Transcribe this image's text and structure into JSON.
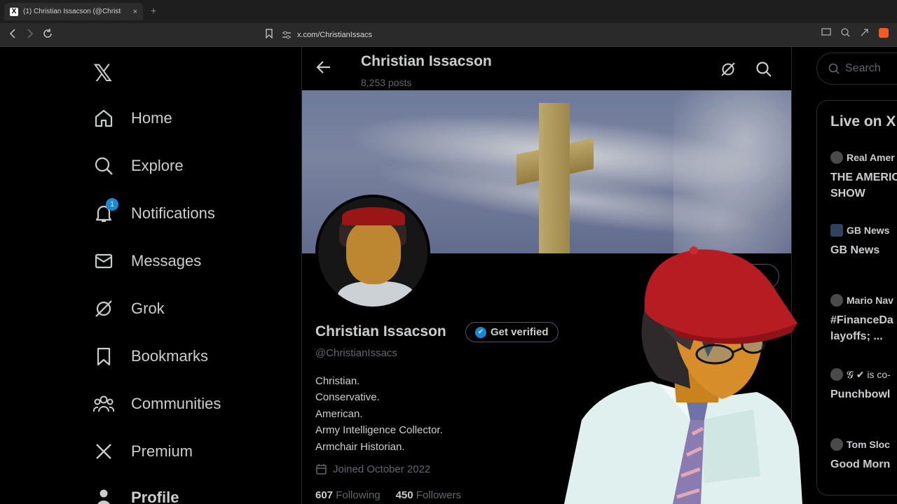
{
  "browser": {
    "tab_title": "(1) Christian Issacson (@ChristianIssacs",
    "tab_close": "×",
    "new_tab": "+",
    "url": "x.com/ChristianIssacs"
  },
  "nav": {
    "logo": "𝕏",
    "items": [
      {
        "label": "Home",
        "icon": "home-icon"
      },
      {
        "label": "Explore",
        "icon": "search-icon"
      },
      {
        "label": "Notifications",
        "icon": "bell-icon",
        "badge": "1"
      },
      {
        "label": "Messages",
        "icon": "envelope-icon"
      },
      {
        "label": "Grok",
        "icon": "grok-icon"
      },
      {
        "label": "Bookmarks",
        "icon": "bookmark-icon"
      },
      {
        "label": "Communities",
        "icon": "people-icon"
      },
      {
        "label": "Premium",
        "icon": "x-icon"
      },
      {
        "label": "Profile",
        "icon": "person-icon"
      }
    ]
  },
  "header": {
    "name": "Christian Issacson",
    "posts": "8,253 posts"
  },
  "profile": {
    "name": "Christian Issacson",
    "verify_label": "Get verified",
    "handle": "@ChristianIssacs",
    "bio": [
      "Christian.",
      "Conservative.",
      "American.",
      "Army Intelligence Collector.",
      "Armchair Historian."
    ],
    "joined": "Joined October 2022",
    "following_count": "607",
    "following_label": "Following",
    "followers_count": "450",
    "followers_label": "Followers"
  },
  "sidebar_right": {
    "search_placeholder": "Search",
    "live_title": "Live on X",
    "live_items": [
      {
        "host": "Real Amer",
        "topic": "THE AMERIC SHOW"
      },
      {
        "host": "GB News",
        "topic": "GB News"
      },
      {
        "host": "Mario Nav",
        "topic": "#FinanceDa layoffs; ..."
      },
      {
        "host": "𝓖 ✔ is co-",
        "topic": "Punchbowl"
      },
      {
        "host": "Tom Sloc",
        "topic": "Good Morn"
      }
    ]
  },
  "colors": {
    "accent": "#1d9bf0",
    "background": "#000000",
    "muted": "#71767b"
  }
}
